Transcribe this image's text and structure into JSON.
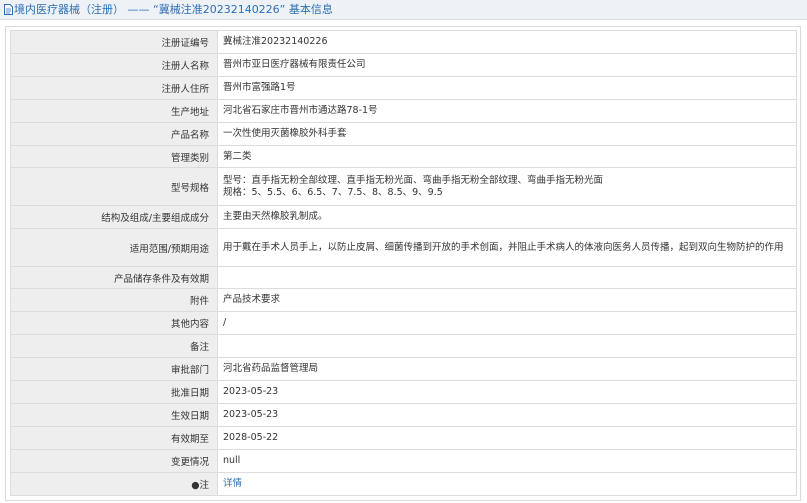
{
  "header": {
    "title_prefix": "境内医疗器械（注册）",
    "separator": "——",
    "title_quote": "“冀械注准20232140226”",
    "title_suffix": "基本信息"
  },
  "rows": [
    {
      "label": "注册证编号",
      "value": "冀械注准20232140226"
    },
    {
      "label": "注册人名称",
      "value": "晋州市亚日医疗器械有限责任公司"
    },
    {
      "label": "注册人住所",
      "value": "晋州市富强路1号"
    },
    {
      "label": "生产地址",
      "value": "河北省石家庄市晋州市通达路78-1号"
    },
    {
      "label": "产品名称",
      "value": "一次性使用灭菌橡胶外科手套"
    },
    {
      "label": "管理类别",
      "value": "第二类"
    },
    {
      "label": "型号规格",
      "value_lines": [
        "型号：直手指无粉全部纹理、直手指无粉光面、弯曲手指无粉全部纹理、弯曲手指无粉光面",
        "规格：5、5.5、6、6.5、7、7.5、8、8.5、9、9.5"
      ]
    },
    {
      "label": "结构及组成/主要组成成分",
      "value": "主要由天然橡胶乳制成。"
    },
    {
      "label": "适用范围/预期用途",
      "value": "用于戴在手术人员手上，以防止皮屑、细菌传播到开放的手术创面，并阻止手术病人的体液向医务人员传播，起到双向生物防护的作用"
    },
    {
      "label": "产品储存条件及有效期",
      "value": ""
    },
    {
      "label": "附件",
      "value": "产品技术要求"
    },
    {
      "label": "其他内容",
      "value": "/"
    },
    {
      "label": "备注",
      "value": ""
    },
    {
      "label": "审批部门",
      "value": "河北省药品监督管理局"
    },
    {
      "label": "批准日期",
      "value": "2023-05-23"
    },
    {
      "label": "生效日期",
      "value": "2023-05-23"
    },
    {
      "label": "有效期至",
      "value": "2028-05-22"
    },
    {
      "label": "变更情况",
      "value": "null"
    },
    {
      "label": "注",
      "label_mark": "●",
      "link": "详情"
    }
  ],
  "colors": {
    "accent": "#2c6fb3",
    "label_bg": "#eeeeee",
    "border": "#dcdcdc"
  }
}
